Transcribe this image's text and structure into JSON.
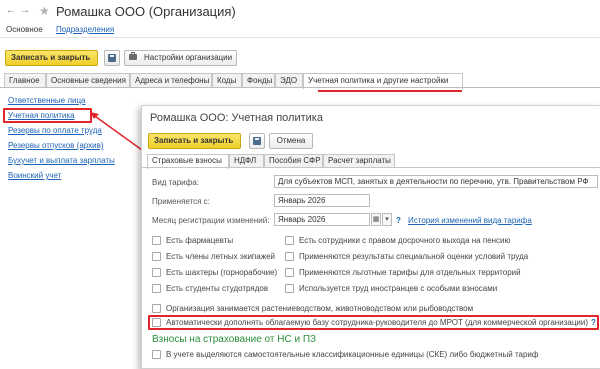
{
  "window": {
    "title": "Ромашка ООО (Организация)",
    "nav": {
      "back": "←",
      "forward": "→"
    },
    "star": "★",
    "subnav": {
      "main": "Основное",
      "link": "Подразделения"
    }
  },
  "toolbar": {
    "save_close": "Записать и закрыть",
    "settings": "Настройки организации"
  },
  "tabs": [
    {
      "label": "Главное"
    },
    {
      "label": "Основные сведения"
    },
    {
      "label": "Адреса и телефоны"
    },
    {
      "label": "Коды"
    },
    {
      "label": "Фонды"
    },
    {
      "label": "ЭДО"
    },
    {
      "label": "Учетная политика и другие настройки"
    }
  ],
  "left_menu": [
    {
      "label": "Ответственные лица"
    },
    {
      "label": "Учетная политика"
    },
    {
      "label": "Резервы по оплате труда"
    },
    {
      "label": "Резервы отпусков (архив)"
    },
    {
      "label": "Бухучет и выплата зарплаты"
    },
    {
      "label": "Воинский учет"
    }
  ],
  "dialog": {
    "title": "Ромашка ООО: Учетная политика",
    "save_close": "Записать и закрыть",
    "cancel": "Отмена",
    "tabs": [
      {
        "label": "Страховые взносы"
      },
      {
        "label": "НДФЛ"
      },
      {
        "label": "Пособия СФР"
      },
      {
        "label": "Расчет зарплаты"
      }
    ],
    "fields": {
      "tariff_label": "Вид тарифа:",
      "tariff_value": "Для субъектов МСП, занятых в деятельности по перечню, утв. Правительством РФ",
      "applied_label": "Применяется с:",
      "applied_value": "Январь 2026",
      "reg_label": "Месяц регистрации изменений:",
      "reg_value": "Январь 2026",
      "history_link": "История изменений вида тарифа",
      "question": "?"
    },
    "checkboxes_left": [
      "Есть фармацевты",
      "Есть члены летных экипажей",
      "Есть шахтеры (горнорабочие)",
      "Есть студенты студотрядов"
    ],
    "checkboxes_right": [
      "Есть сотрудники с правом досрочного выхода на пенсию",
      "Применяются результаты специальной оценки условий труда",
      "Применяются льготные тарифы для отдельных территорий",
      "Используется труд иностранцев с особыми взносами"
    ],
    "agri": "Организация занимается растениеводством, животноводством или рыбоводством",
    "auto_mrot": "Автоматически дополнять облагаемую базу сотрудника-руководителя до МРОТ (для коммерческой организации)",
    "section_title": "Взносы на страхование от НС и ПЗ",
    "ske": "В учете выделяются самостоятельные классификационные единицы (СКЕ) либо бюджетный тариф"
  },
  "colors": {
    "accent_red": "#e0252b",
    "link_blue": "#1d63b7",
    "save_yellow": "#f0cf2b",
    "section_green": "#2a8f3a"
  }
}
